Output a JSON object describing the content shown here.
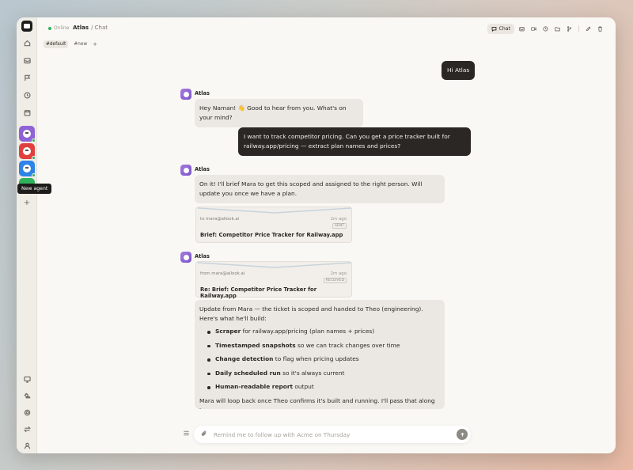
{
  "app": {
    "status": "Online",
    "agent_name": "Atlas",
    "breadcrumb_sep": "/ Chat"
  },
  "toolbar": {
    "chat_label": "Chat",
    "icons": [
      "inbox-icon",
      "video-icon",
      "history-icon",
      "folder-icon",
      "branch-icon",
      "edit-icon",
      "trash-icon"
    ]
  },
  "tags": {
    "default": "#default",
    "new": "#new",
    "add": "+"
  },
  "sidebar": {
    "tooltip": "New agent",
    "add": "+",
    "agents": [
      {
        "color": "#8f62d6"
      },
      {
        "color": "#e0413f"
      },
      {
        "color": "#2d83e6"
      },
      {
        "color": "#2fb35a"
      }
    ]
  },
  "messages": {
    "user1": "Hi Atlas",
    "bot_name": "Atlas",
    "bot1": "Hey Naman! 👋 Good to hear from you. What's on your mind?",
    "user2": "I want to track competitor pricing. Can you get a price tracker built for railway.app/pricing — extract plan names and prices?",
    "bot2": "On it! I'll brief Mara to get this scoped and assigned to the right person. Will update you once we have a plan.",
    "card1": {
      "meta": "to mara@allook.ai",
      "time": "2m ago",
      "label": "SENT",
      "title": "Brief: Competitor Price Tracker for Railway.app"
    },
    "card2": {
      "meta": "from mara@allook.ai",
      "time": "2m ago",
      "label": "RECEIVED",
      "title": "Re: Brief: Competitor Price Tracker for Railway.app"
    },
    "bot3_intro": "Update from Mara — the ticket is scoped and handed to Theo (engineering). Here's what he'll build:",
    "bullets": [
      {
        "bold": "Scraper",
        "rest": " for railway.app/pricing (plan names + prices)"
      },
      {
        "bold": "Timestamped snapshots",
        "rest": " so we can track changes over time"
      },
      {
        "bold": "Change detection",
        "rest": " to flag when pricing updates"
      },
      {
        "bold": "Daily scheduled run",
        "rest": " so it's always current"
      },
      {
        "bold": "Human-readable report",
        "rest": " output"
      }
    ],
    "bot3_outro": "Mara will loop back once Theo confirms it's built and running. I'll pass that along to you."
  },
  "composer": {
    "placeholder": "Remind me to follow up with Acme on Thursday"
  }
}
